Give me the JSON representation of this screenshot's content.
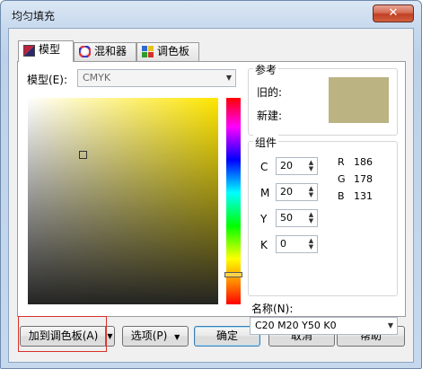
{
  "window": {
    "title": "均匀填充",
    "close_glyph": "✕"
  },
  "tabs": [
    {
      "label": "模型",
      "icon": "color-model-icon",
      "active": true
    },
    {
      "label": "混和器",
      "icon": "color-wheel-icon",
      "active": false
    },
    {
      "label": "调色板",
      "icon": "palette-grid-icon",
      "active": false
    }
  ],
  "model": {
    "label": "模型(E):",
    "value": "CMYK"
  },
  "reference": {
    "title": "参考",
    "old_label": "旧的:",
    "new_label": "新建:",
    "swatch_color": "#bcb383"
  },
  "components": {
    "title": "组件",
    "c": {
      "label": "C",
      "value": "20"
    },
    "m": {
      "label": "M",
      "value": "20"
    },
    "y": {
      "label": "Y",
      "value": "50"
    },
    "k": {
      "label": "K",
      "value": "0"
    },
    "r": {
      "label": "R",
      "value": "186"
    },
    "g": {
      "label": "G",
      "value": "178"
    },
    "b": {
      "label": "B",
      "value": "131"
    }
  },
  "name_field": {
    "label": "名称(N):",
    "value": "C20 M20 Y50 K0"
  },
  "color_field": {
    "top_right_color": "#ffe600"
  },
  "buttons": {
    "add_palette": "加到调色板(A)",
    "add_palette_arrow": "▼",
    "options": "选项(P)",
    "options_arrow": "▼",
    "ok": "确定",
    "cancel": "取消",
    "help": "帮助"
  }
}
